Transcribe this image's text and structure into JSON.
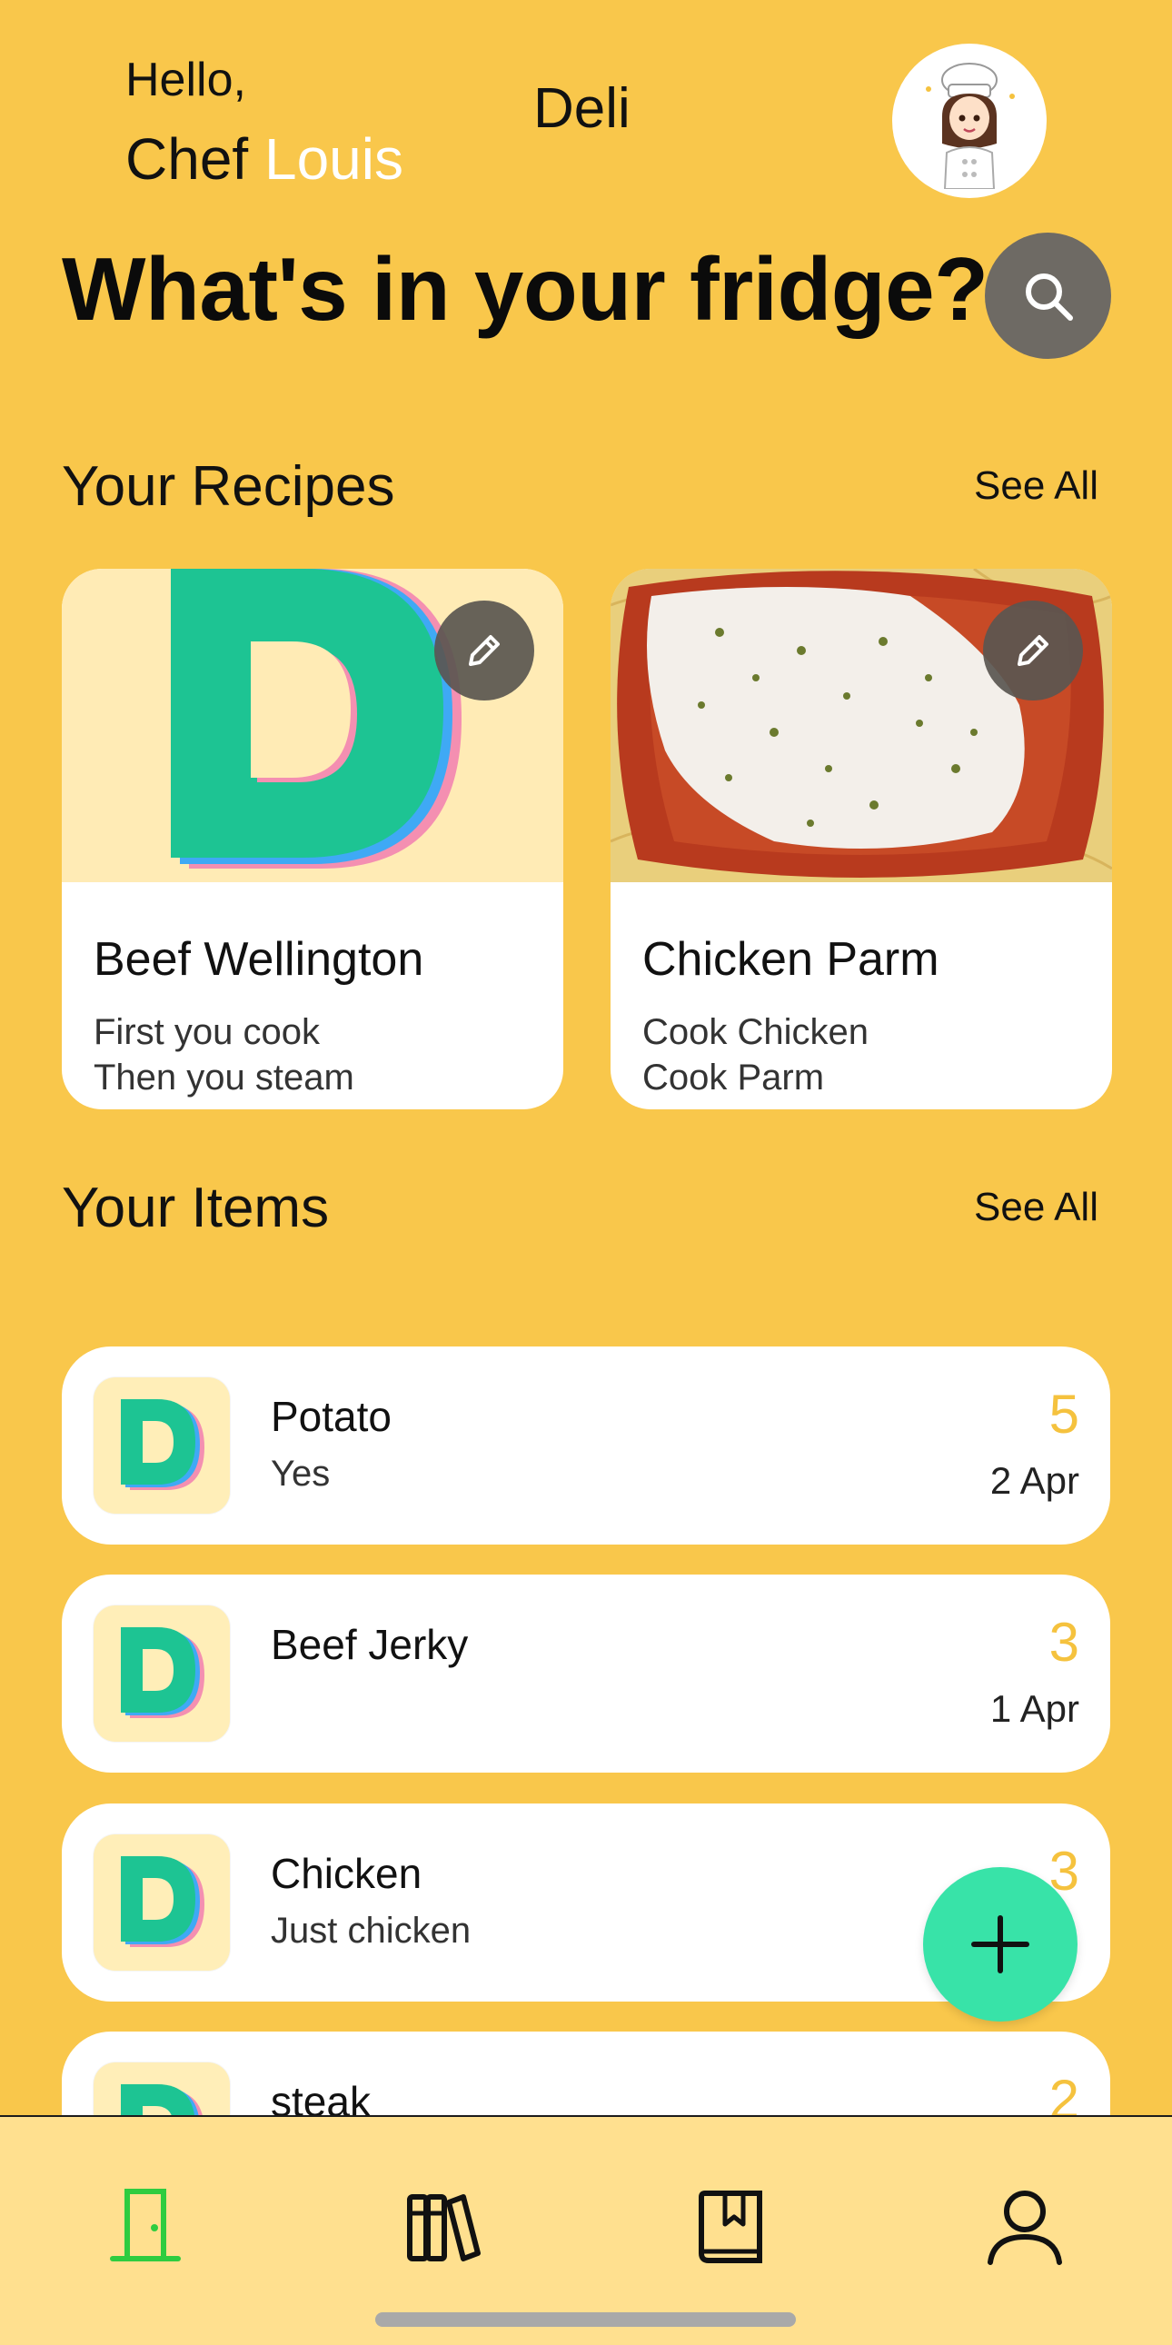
{
  "header": {
    "greeting": "Hello,",
    "chef_prefix": "Chef",
    "chef_name": "Louis",
    "app_title": "Deli",
    "headline": "What's in your fridge?"
  },
  "recipes_section": {
    "title": "Your Recipes",
    "see_all": "See All",
    "cards": [
      {
        "title": "Beef Wellington",
        "line1": "First you cook",
        "line2": "Then you steam"
      },
      {
        "title": "Chicken Parm",
        "line1": "Cook Chicken",
        "line2": "Cook Parm"
      }
    ]
  },
  "items_section": {
    "title": "Your Items",
    "see_all": "See All",
    "items": [
      {
        "name": "Potato",
        "desc": "Yes",
        "qty": "5",
        "date": "2 Apr"
      },
      {
        "name": "Beef Jerky",
        "desc": "",
        "qty": "3",
        "date": "1 Apr"
      },
      {
        "name": "Chicken",
        "desc": "Just chicken",
        "qty": "3",
        "date": ""
      },
      {
        "name": "steak",
        "desc": "",
        "qty": "2",
        "date": ""
      }
    ]
  },
  "tabbar": {
    "tabs": [
      {
        "icon": "door-icon",
        "active": true
      },
      {
        "icon": "books-icon",
        "active": false
      },
      {
        "icon": "bookmark-book-icon",
        "active": false
      },
      {
        "icon": "profile-icon",
        "active": false
      }
    ]
  },
  "colors": {
    "background": "#F9C74B",
    "accent_name": "#FFFFFF",
    "quantity": "#F5C23E",
    "fab": "#38E3A8",
    "tabbar": "#FFE08F",
    "active_tab": "#2ECC40"
  }
}
